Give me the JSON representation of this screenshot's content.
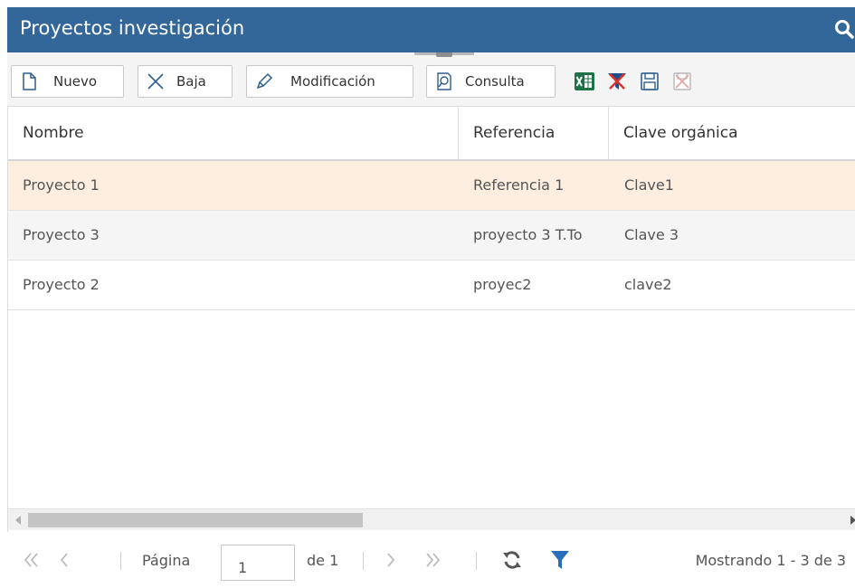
{
  "window": {
    "title": "Proyectos investigación"
  },
  "colors": {
    "header_bg": "#336699",
    "selected_row": "#fdeee0",
    "alt_row": "#f5f5f5",
    "excel_green": "#1e7145",
    "filter_blue": "#2a6ebb"
  },
  "toolbar": {
    "nuevo_label": "Nuevo",
    "baja_label": "Baja",
    "modificacion_label": "Modificación",
    "consulta_label": "Consulta",
    "icons": [
      "new-document-icon",
      "delete-x-icon",
      "pencil-icon",
      "search-document-icon",
      "excel-export-icon",
      "clear-filter-icon",
      "save-icon",
      "clear-save-icon"
    ]
  },
  "grid": {
    "columns": [
      "Nombre",
      "Referencia",
      "Clave orgánica"
    ],
    "rows": [
      {
        "nombre": "Proyecto 1",
        "referencia": "Referencia 1",
        "clave": "Clave1",
        "selected": true
      },
      {
        "nombre": "Proyecto 3",
        "referencia": "proyecto 3 T.To",
        "clave": "Clave 3",
        "selected": false
      },
      {
        "nombre": "Proyecto 2",
        "referencia": "proyec2",
        "clave": "clave2",
        "selected": false
      }
    ]
  },
  "pager": {
    "page_label": "Página",
    "current_page": "1",
    "total_label": "de 1",
    "status": "Mostrando 1 - 3 de 3"
  }
}
